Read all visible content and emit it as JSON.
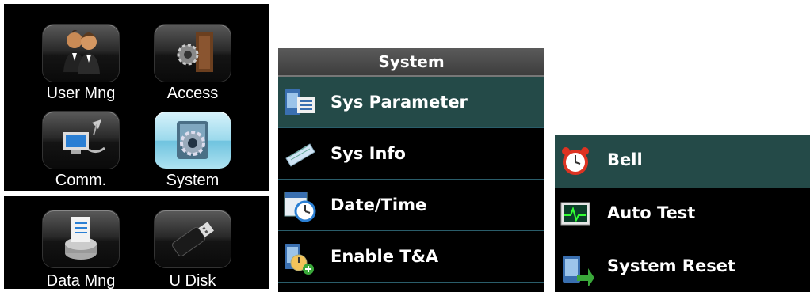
{
  "main_menu_top": {
    "tiles": [
      {
        "label": "User Mng",
        "icon": "users-icon"
      },
      {
        "label": "Access",
        "icon": "door-gear-icon"
      },
      {
        "label": "Comm.",
        "icon": "network-computer-icon"
      },
      {
        "label": "System",
        "icon": "system-gear-icon",
        "selected": true
      }
    ]
  },
  "main_menu_bottom": {
    "tiles": [
      {
        "label": "Data Mng",
        "icon": "database-icon"
      },
      {
        "label": "U Disk",
        "icon": "usb-drive-icon"
      }
    ]
  },
  "system_menu": {
    "title": "System",
    "items": [
      {
        "label": "Sys Parameter",
        "icon": "sys-parameter-icon",
        "selected": true
      },
      {
        "label": "Sys Info",
        "icon": "sys-info-icon"
      },
      {
        "label": "Date/Time",
        "icon": "calendar-clock-icon"
      },
      {
        "label": "Enable T&A",
        "icon": "enable-ta-icon"
      }
    ]
  },
  "system_menu_more": {
    "items": [
      {
        "label": "Bell",
        "icon": "alarm-clock-icon",
        "selected": true
      },
      {
        "label": "Auto Test",
        "icon": "waveform-monitor-icon"
      },
      {
        "label": "System Reset",
        "icon": "system-reset-icon"
      }
    ]
  },
  "colors": {
    "selected_row": "#244a48",
    "selected_tile": "#9bd9ec",
    "divider": "#2a5d6a"
  }
}
